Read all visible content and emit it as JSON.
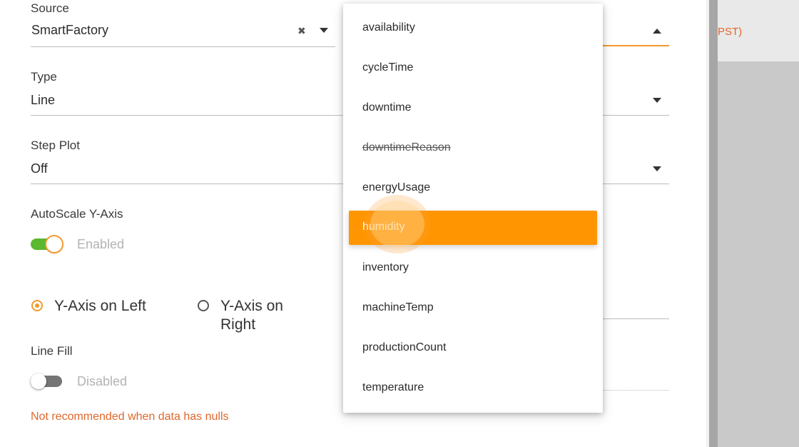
{
  "colors": {
    "accent": "#ff9500",
    "toggle_on": "#5cb82e",
    "toggle_off": "#757575",
    "hint": "#e0672b"
  },
  "background": {
    "partial_text": "PST)"
  },
  "source": {
    "label": "Source",
    "value": "SmartFactory",
    "clear_icon": "close-icon",
    "arrow_icon": "chevron-down-icon"
  },
  "type": {
    "label": "Type",
    "value": "Line"
  },
  "step_plot": {
    "label": "Step Plot",
    "value": "Off"
  },
  "autoscale": {
    "label": "AutoScale Y-Axis",
    "state_text": "Enabled",
    "on": true
  },
  "y_axis": {
    "left_label": "Y-Axis on Left",
    "right_label": "Y-Axis on Right",
    "selected": "left"
  },
  "line_fill": {
    "label": "Line Fill",
    "state_text": "Disabled",
    "on": false,
    "hint": "Not recommended when data has nulls"
  },
  "dropdown": {
    "items": [
      {
        "label": "availability"
      },
      {
        "label": "cycleTime"
      },
      {
        "label": "downtime"
      },
      {
        "label": "downtimeReason",
        "disabled": true
      },
      {
        "label": "energyUsage"
      },
      {
        "label": "humidity",
        "selected": true
      },
      {
        "label": "inventory"
      },
      {
        "label": "machineTemp"
      },
      {
        "label": "productionCount"
      },
      {
        "label": "temperature"
      }
    ]
  }
}
